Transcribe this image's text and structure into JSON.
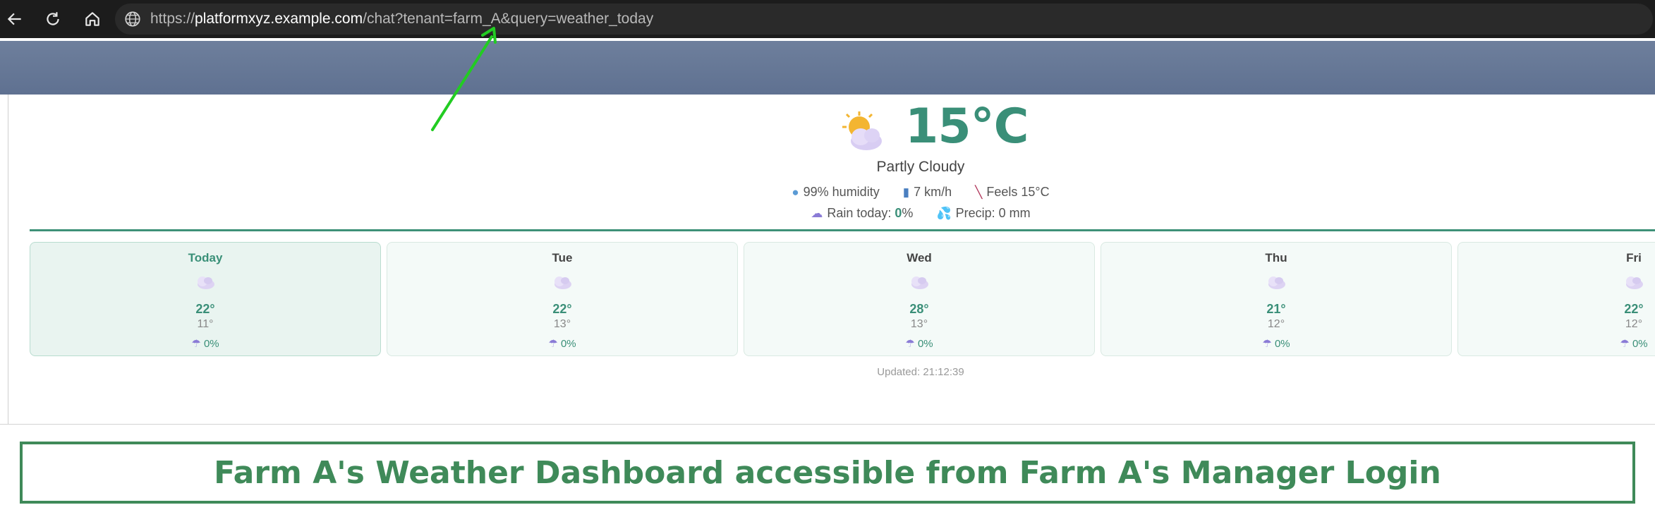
{
  "browser": {
    "url_prefix": "https://",
    "url_host": "platformxyz.example.com",
    "url_path": "/chat?tenant=farm_A&query=weather_today"
  },
  "current": {
    "temperature": "15°C",
    "condition": "Partly Cloudy",
    "humidity": "99% humidity",
    "wind": "7 km/h",
    "feels": "Feels 15°C",
    "rain_label": "Rain today: ",
    "rain_value": "0",
    "rain_unit": "%",
    "precip": "Precip: 0 mm"
  },
  "forecast": [
    {
      "day": "Today",
      "high": "22°",
      "low": "11°",
      "rain": "0%"
    },
    {
      "day": "Tue",
      "high": "22°",
      "low": "13°",
      "rain": "0%"
    },
    {
      "day": "Wed",
      "high": "28°",
      "low": "13°",
      "rain": "0%"
    },
    {
      "day": "Thu",
      "high": "21°",
      "low": "12°",
      "rain": "0%"
    },
    {
      "day": "Fri",
      "high": "22°",
      "low": "12°",
      "rain": "0%"
    }
  ],
  "updated": "Updated: 21:12:39",
  "caption": "Farm A's Weather Dashboard accessible from Farm A's Manager Login",
  "icons": {
    "back": "back-arrow-icon",
    "reload": "reload-icon",
    "home": "home-icon",
    "site": "globe-icon",
    "weather": "partly-cloudy-icon",
    "humidity": "water-drop-icon",
    "wind": "wind-icon",
    "feels": "thermometer-icon",
    "rain": "rain-cloud-icon",
    "precip": "splash-icon"
  },
  "colors": {
    "accent": "#3a8f78",
    "caption": "#3f8a59",
    "arrow": "#22cc22"
  }
}
